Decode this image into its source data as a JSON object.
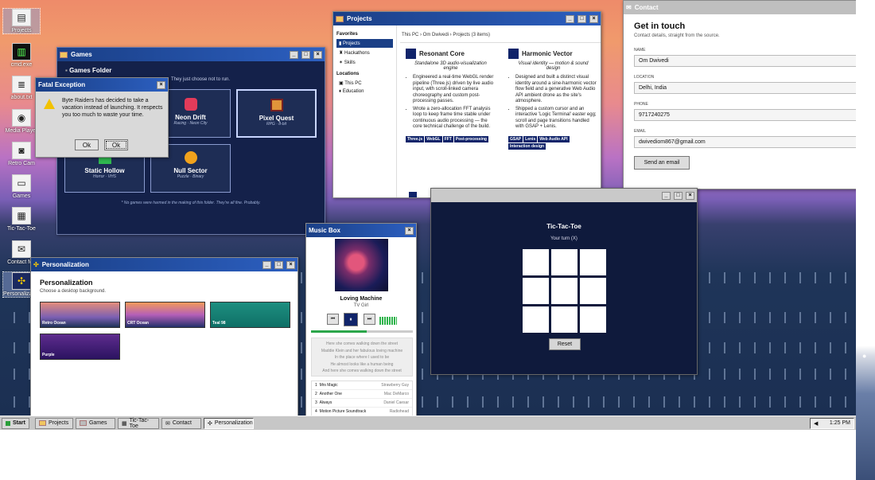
{
  "desktop_icons": [
    {
      "label": "Projects",
      "icon": "folder-icon"
    },
    {
      "label": "cmd.exe",
      "icon": "terminal-icon"
    },
    {
      "label": "about.txt",
      "icon": "document-icon"
    },
    {
      "label": "Media Player",
      "icon": "media-icon"
    },
    {
      "label": "Retro Cam",
      "icon": "camera-icon"
    },
    {
      "label": "Games",
      "icon": "gamepad-icon"
    },
    {
      "label": "Tic-Tac-Toe",
      "icon": "grid-icon"
    },
    {
      "label": "Contact Me",
      "icon": "mail-icon"
    },
    {
      "label": "Personalization",
      "icon": "palette-icon"
    }
  ],
  "games": {
    "title": "Games",
    "heading": "Games Folder",
    "tagline": "They just choose not to run.",
    "cards": [
      {
        "name": "Neon Drift",
        "sub": "Racing · Neon City"
      },
      {
        "name": "Pixel Quest",
        "sub": "RPG · 8-bit"
      },
      {
        "name": "Static Hollow",
        "sub": "Horror · VHS"
      },
      {
        "name": "Null Sector",
        "sub": "Puzzle · Binary"
      }
    ],
    "footnote": "* No games were harmed in the making of this folder. They're all fine. Probably."
  },
  "dialog": {
    "title": "Fatal Exception",
    "message": "Byte Raiders has decided to take a vacation instead of launching. It respects you too much to waste your time.",
    "ok1": "Ok",
    "ok2": "Ok"
  },
  "projects": {
    "title": "Projects",
    "sidebar": {
      "favorites_label": "Favorites",
      "favorites": [
        "Projects",
        "Hackathons",
        "Skills"
      ],
      "locations_label": "Locations",
      "locations": [
        "This PC",
        "Education"
      ]
    },
    "breadcrumb": "This PC  ›  Om Dwivedi  ›  Projects (3 items)",
    "cards": [
      {
        "name": "Resonant Core",
        "sub": "Standalone 3D audio-visualization engine",
        "bullets": [
          "Engineered a real-time WebGL render pipeline (Three.js) driven by live audio input, with scroll-linked camera choreography and custom post-processing passes.",
          "Wrote a zero-allocation FFT analysis loop to keep frame time stable under continuous audio processing — the core technical challenge of the build."
        ],
        "tags": [
          "Three.js",
          "WebGL",
          "FFT",
          "Post-processing"
        ]
      },
      {
        "name": "Harmonic Vector",
        "sub": "Visual identity — motion & sound design",
        "bullets": [
          "Designed and built a distinct visual identity around a sine-harmonic vector flow field and a generative Web Audio API ambient drone as the site's atmosphere.",
          "Shipped a custom cursor and an interactive 'Logic Terminal' easter egg; scroll and page transitions handled with GSAP + Lenis."
        ],
        "tags": [
          "GSAP",
          "Lenis",
          "Web Audio API",
          "Interaction design"
        ]
      }
    ]
  },
  "contact": {
    "title": "Contact",
    "heading": "Get in touch",
    "sub": "Contact details, straight from the source.",
    "fields": [
      {
        "label": "Name",
        "value": "Om Dwivedi"
      },
      {
        "label": "Location",
        "value": "Delhi, India"
      },
      {
        "label": "Phone",
        "value": "9717240275"
      },
      {
        "label": "Email",
        "value": "dwivediom867@gmail.com"
      }
    ],
    "button": "Send an email"
  },
  "music": {
    "title": "Music Box",
    "song": "Loving Machine",
    "artist": "TV Girl",
    "progress": 0.55,
    "lyrics": [
      "Here she comes walking down the street",
      "Maddie Klein and her fabulous loving machine",
      "In the place where I used to be",
      "He almost looks like a human being",
      "And here she comes walking down the street"
    ],
    "tracks": [
      {
        "n": "1",
        "name": "Mrs Magic",
        "artist": "Strawberry Guy"
      },
      {
        "n": "2",
        "name": "Another One",
        "artist": "Mac DeMarco"
      },
      {
        "n": "3",
        "name": "Always",
        "artist": "Daniel Caesar"
      },
      {
        "n": "4",
        "name": "Motion Picture Soundtrack",
        "artist": "Radiohead"
      }
    ]
  },
  "tictactoe": {
    "title": "Tic-Tac-Toe",
    "status": "Your turn (X)",
    "reset": "Reset"
  },
  "personalization": {
    "title": "Personalization",
    "heading": "Personalization",
    "sub": "Choose a desktop background.",
    "backgrounds": [
      "Retro Ocean",
      "CRT Ocean",
      "Teal 98",
      "Purple"
    ]
  },
  "taskbar": {
    "start": "Start",
    "items": [
      "Projects",
      "Games",
      "Tic-Tac-Toe",
      "Contact",
      "Personalization"
    ],
    "time": "1:25 PM"
  },
  "colors": {
    "accent": "#1a3f86",
    "navy": "#0f1a3c",
    "pill": "#10246a"
  }
}
